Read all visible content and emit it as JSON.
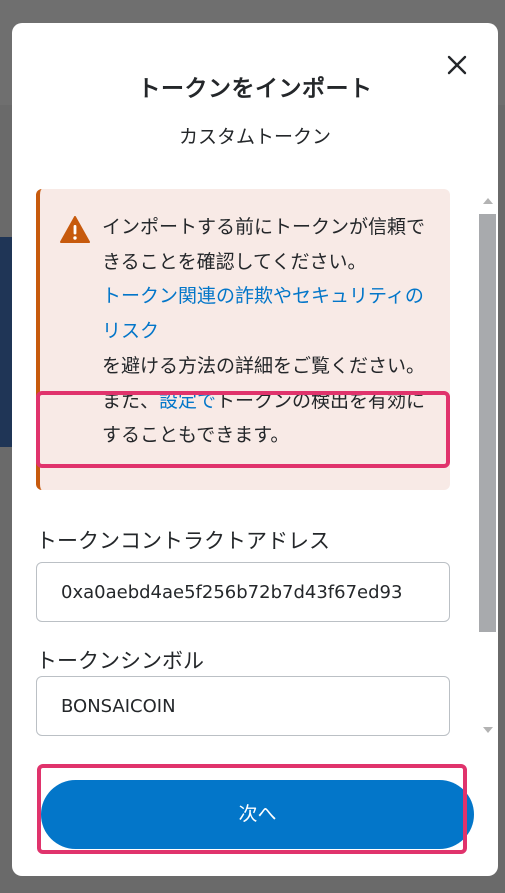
{
  "modal": {
    "title": "トークンをインポート",
    "close_icon": "close-icon",
    "tab_label": "カスタムトークン"
  },
  "warning": {
    "icon": "warning-icon",
    "text_1": "インポートする前にトークンが信頼できることを確認してください。",
    "link_1": "トークン関連の詐欺やセキュリティのリスク",
    "text_2": "を避ける方法の詳細をご覧ください。また、",
    "link_2": "設定で",
    "text_3": "トークンの検出を有効にすることもできます。"
  },
  "form": {
    "address_label": "トークンコントラクトアドレス",
    "address_value": "0xa0aebd4ae5f256b72b7d43f67ed93",
    "symbol_label": "トークンシンボル",
    "symbol_value": "BONSAICOIN"
  },
  "footer": {
    "next_label": "次へ"
  },
  "colors": {
    "accent": "#0376c9",
    "warning_border": "#c75a0d",
    "warning_bg": "#f8eae6",
    "highlight": "#e0336c"
  }
}
